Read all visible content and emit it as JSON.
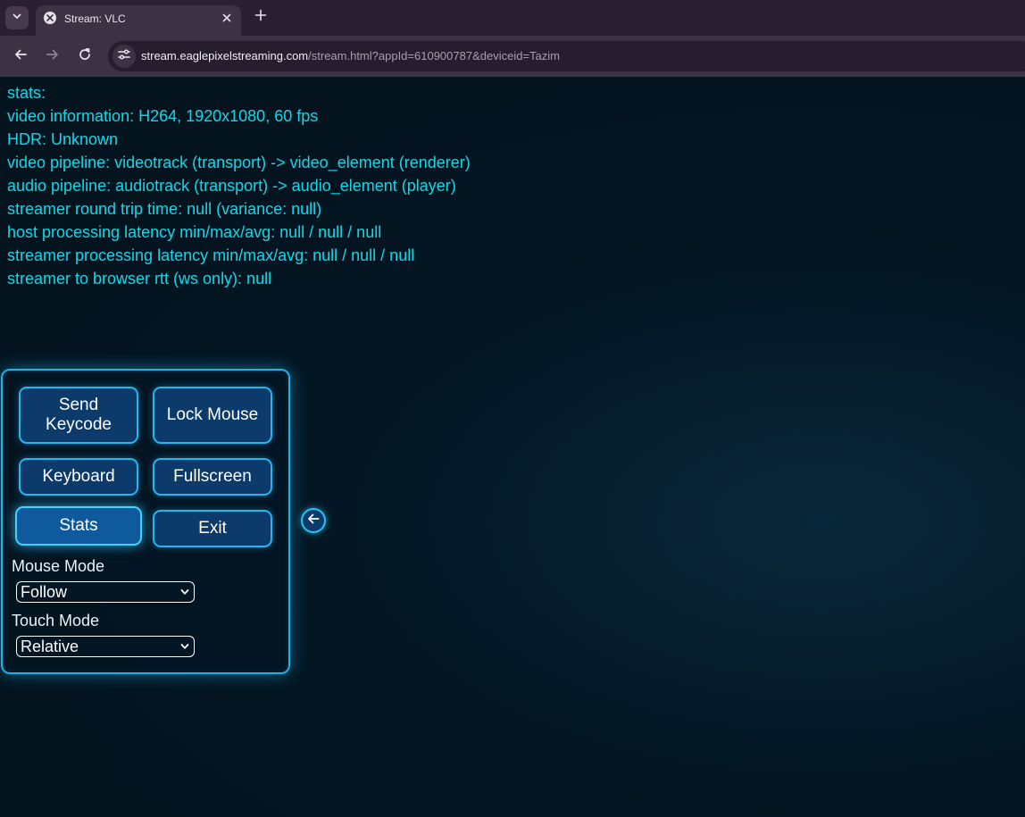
{
  "browser": {
    "tab": {
      "title": "Stream: VLC"
    },
    "address_bar": {
      "url_host": "stream.eaglepixelstreaming.com",
      "url_path": "/stream.html?appId=610900787&deviceid=Tazim"
    },
    "icons": {
      "tab_search": "chevron-down-icon",
      "favicon": "app-icon",
      "close_tab": "close-icon",
      "new_tab": "plus-icon",
      "back": "arrow-left-icon",
      "forward": "arrow-right-icon",
      "reload": "reload-icon",
      "site_info": "tune-icon"
    }
  },
  "stats": {
    "lines": [
      "stats:",
      "video information: H264, 1920x1080, 60 fps",
      "HDR: Unknown",
      "video pipeline: videotrack (transport) -> video_element (renderer)",
      "audio pipeline: audiotrack (transport) -> audio_element (player)",
      "streamer round trip time: null (variance: null)",
      "host processing latency min/max/avg: null / null / null",
      "streamer processing latency min/max/avg: null / null / null",
      "streamer to browser rtt (ws only): null"
    ]
  },
  "panel": {
    "buttons": {
      "send_keycode_1": "Send",
      "send_keycode_2": "Keycode",
      "lock_mouse": "Lock Mouse",
      "keyboard": "Keyboard",
      "fullscreen": "Fullscreen",
      "stats": "Stats",
      "exit": "Exit"
    },
    "mouse_mode": {
      "label": "Mouse Mode",
      "selected": "Follow"
    },
    "touch_mode": {
      "label": "Touch Mode",
      "selected": "Relative"
    },
    "collapse_icon": "arrow-left-circle-icon"
  },
  "colors": {
    "stats_text": "#11d8e8",
    "panel_border": "#1bb4e6",
    "button_fill": "#0b3a6b",
    "tab_bar": "#2b1f32",
    "toolbar": "#3d3244"
  }
}
